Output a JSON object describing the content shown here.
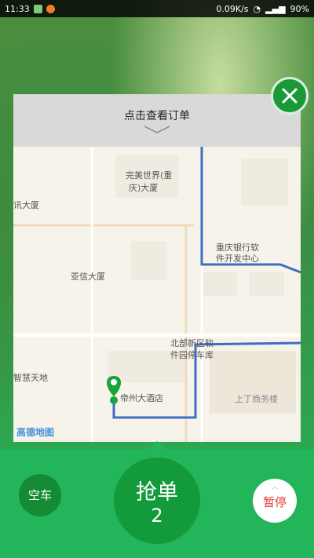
{
  "status_bar": {
    "time": "11:33",
    "network_speed": "0.09K/s",
    "battery": "90%"
  },
  "card": {
    "title": "点击查看订单"
  },
  "map": {
    "labels": {
      "perfect_world": "完美世界(重",
      "perfect_world_2": "庆)大厦",
      "xun_building": "讯大厦",
      "cq_bank_1": "重庆银行软",
      "cq_bank_2": "件开发中心",
      "yaxin": "亚信大厦",
      "beibu_1": "北部新区软",
      "beibu_2": "件园停车库",
      "zhihui": "智慧天地",
      "dizhou_hotel": "帝州大酒店",
      "shangding": "上丁商务楼"
    },
    "logo": "高德地图"
  },
  "controls": {
    "empty_car": "空车",
    "grab_order": "抢单",
    "grab_count": "2",
    "pause": "暂停"
  },
  "colors": {
    "primary_green": "#22b55a",
    "dark_green": "#139a3a",
    "route_blue": "#3f6cc4",
    "pause_red": "#e53935"
  }
}
